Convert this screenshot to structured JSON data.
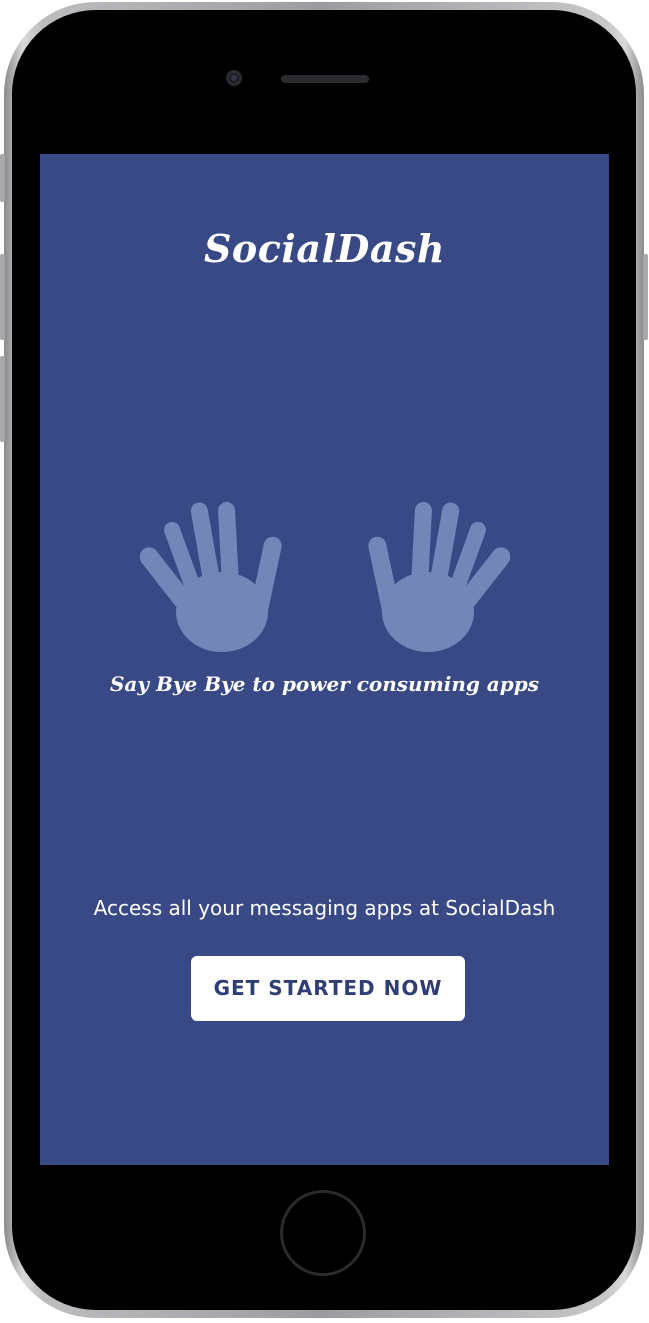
{
  "app": {
    "title": "SocialDash",
    "tagline": "Say Bye Bye to power consuming apps",
    "subtitle": "Access all your messaging apps at SocialDash",
    "cta_label": "GET STARTED NOW"
  },
  "icons": {
    "hands": "waving-hands-icon"
  },
  "colors": {
    "background": "#384985",
    "hands": "#7486b8",
    "button_bg": "#ffffff",
    "button_text": "#2f3e74",
    "text": "#ffffff"
  }
}
